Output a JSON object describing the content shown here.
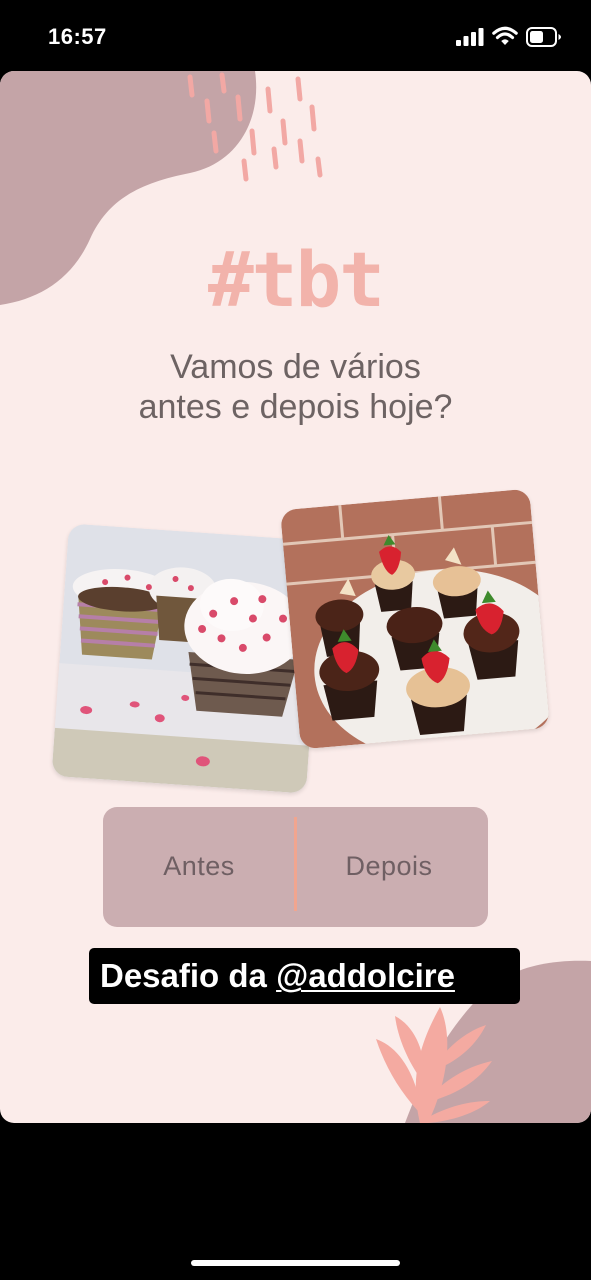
{
  "status_bar": {
    "time": "16:57",
    "icons": [
      "cellular-signal-icon",
      "wifi-icon",
      "battery-icon"
    ]
  },
  "story": {
    "hashtag": "#tbt",
    "question_line1": "Vamos de vários",
    "question_line2": "antes e depois hoje?",
    "before_label": "Antes",
    "after_label": "Depois",
    "caption_prefix": "Desafio da ",
    "caption_mention": "@addolcire",
    "photos": [
      "cupcakes-before-photo",
      "cupcakes-after-photo"
    ],
    "decoration_icon": "leaf-icon"
  },
  "colors": {
    "background": "#fbecea",
    "accent_pink": "#f2b3ab",
    "blob_mauve": "#c4a4a7",
    "panel": "#cbaeb1",
    "divider": "#f1a58f",
    "text_gray": "#6d6363"
  }
}
